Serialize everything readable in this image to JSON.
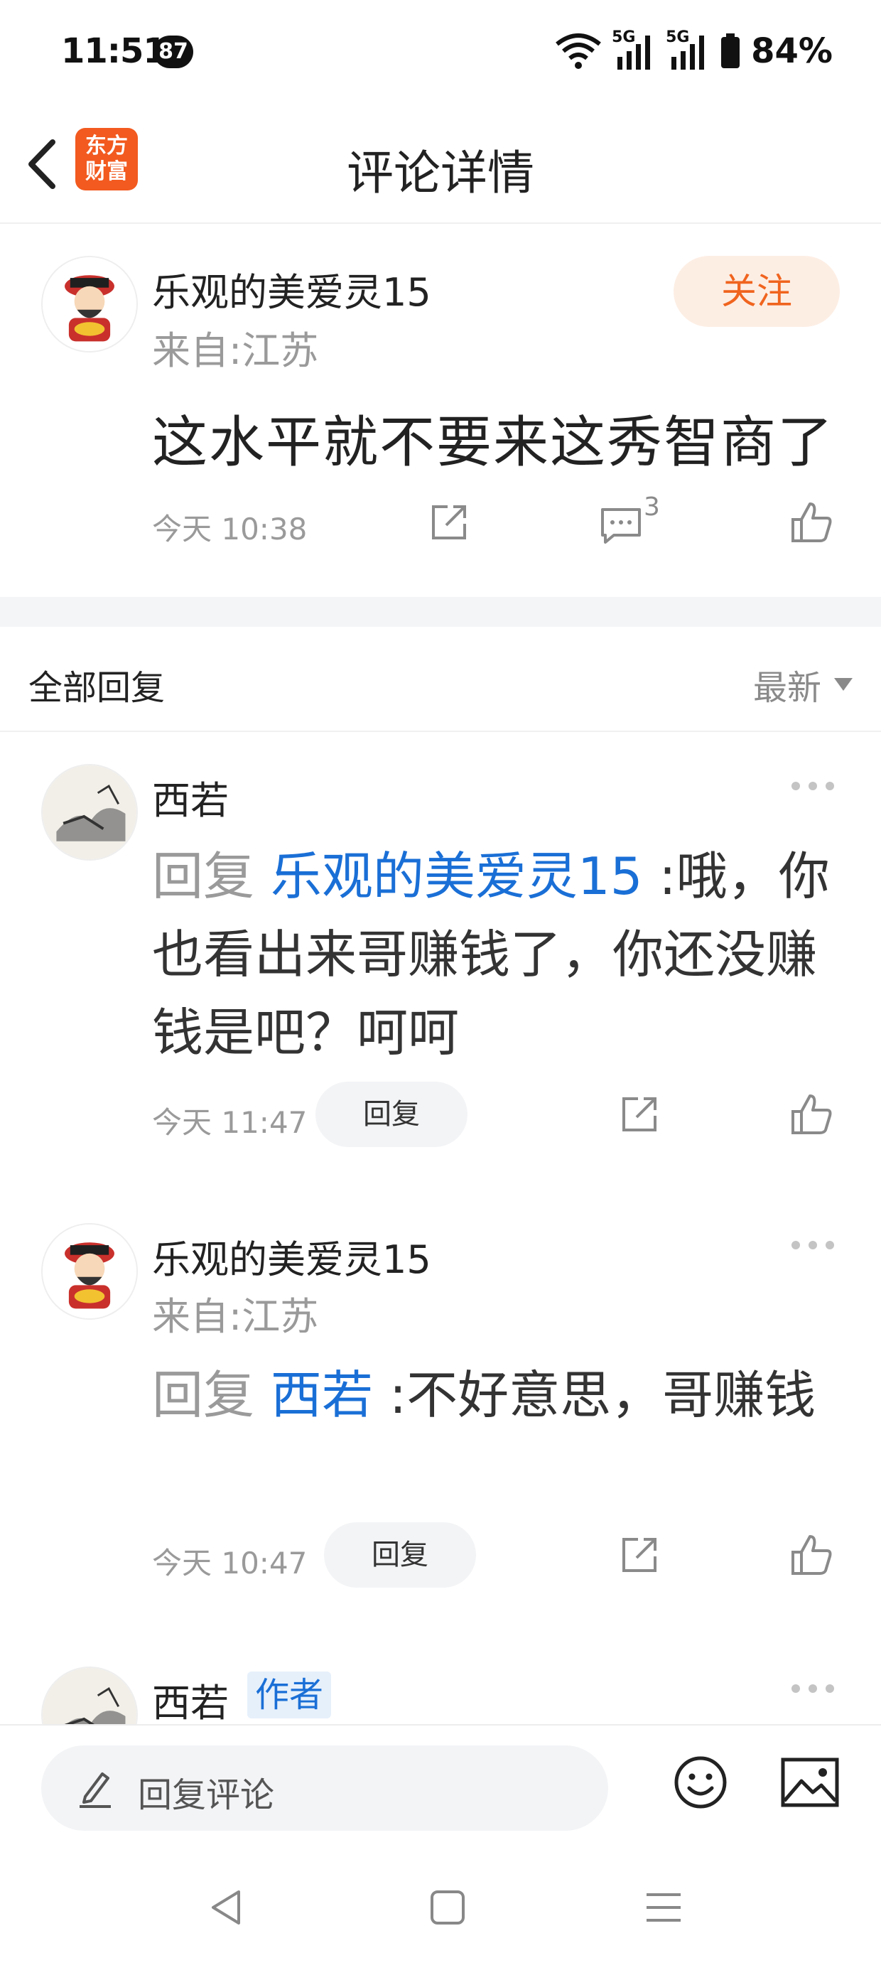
{
  "status_bar": {
    "time": "11:51",
    "notification_badge": "87",
    "battery": "84%",
    "network_1": "5G",
    "network_2": "5G"
  },
  "header": {
    "logo_line1": "东方",
    "logo_line2": "财富",
    "title": "评论详情"
  },
  "main_comment": {
    "username": "乐观的美爱灵15",
    "location": "来自:江苏",
    "follow_label": "关注",
    "text": "这水平就不要来这秀智商了",
    "time": "今天 10:38",
    "reply_count": "3"
  },
  "replies_header": {
    "title": "全部回复",
    "sort_label": "最新"
  },
  "replies": [
    {
      "username": "西若",
      "reply_prefix": "回复",
      "reply_to": "乐观的美爱灵15",
      "separator": ":",
      "text": "哦，你也看出来哥赚钱了，你还没赚钱是吧？呵呵",
      "time": "今天 11:47",
      "reply_label": "回复"
    },
    {
      "username": "乐观的美爱灵15",
      "location": "来自:江苏",
      "reply_prefix": "回复",
      "reply_to": "西若",
      "separator": ":",
      "text": "不好意思，哥赚钱",
      "time": "今天 10:47",
      "reply_label": "回复"
    },
    {
      "username": "西若",
      "author_tag": "作者"
    }
  ],
  "bottom_bar": {
    "placeholder": "回复评论"
  },
  "colors": {
    "accent_orange": "#f0641e",
    "link_blue": "#1a6fd6",
    "logo_bg": "#f25a1f"
  }
}
